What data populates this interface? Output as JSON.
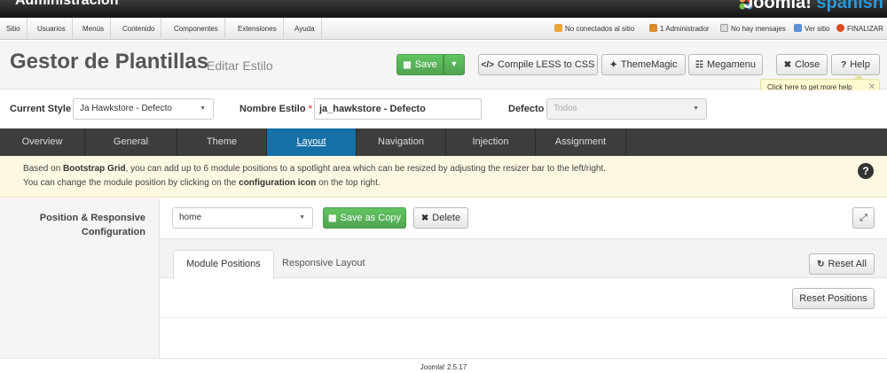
{
  "header": {
    "admin_title": "Administración",
    "logo_text": "Joomla!",
    "logo_suffix": "spanish"
  },
  "menu": {
    "items": [
      "Sitio",
      "Usuarios",
      "Menús",
      "Contenido",
      "Componentes",
      "Extensiones",
      "Ayuda"
    ]
  },
  "status": {
    "not_connected": "No conectados al sitio",
    "admins": "1 Administrador",
    "messages": "No hay mensajes",
    "view_site": "Ver sitio",
    "logout": "FINALIZAR"
  },
  "toolbar": {
    "title": "Gestor de Plantillas",
    "subtitle": "Editar Estilo",
    "save_label": "Save",
    "compile_label": "Compile LESS to CSS",
    "thememagic_label": "ThemeMagic",
    "megamenu_label": "Megamenu",
    "close_label": "Close",
    "help_label": "Help",
    "help_tooltip": "Click here to get more help"
  },
  "style_form": {
    "current_style_label": "Current Style",
    "current_style_value": "Ja Hawkstore - Defecto",
    "style_name_label": "Nombre Estilo",
    "style_name_value": "ja_hawkstore - Defecto",
    "default_label": "Defecto",
    "default_value": "Todos"
  },
  "tabs": [
    "Overview",
    "General",
    "Theme",
    "Layout",
    "Navigation",
    "Injection",
    "Assignment"
  ],
  "active_tab": "Layout",
  "info": {
    "line1_pre": "Based on ",
    "line1_bold": "Bootstrap Grid",
    "line1_post": ", you can add up to 6 module positions to a spotlight area which can be resized by adjusting the resizer bar to the left/right.",
    "line2_pre": "You can change the module position by clicking on the ",
    "line2_bold": "configuration icon",
    "line2_post": " on the top right."
  },
  "config": {
    "label_line1": "Position & Responsive",
    "label_line2": "Configuration",
    "layout_select": "home",
    "save_copy_label": "Save as Copy",
    "delete_label": "Delete",
    "subtabs": [
      "Module Positions",
      "Responsive Layout"
    ],
    "reset_all_label": "Reset All",
    "reset_positions_label": "Reset Positions"
  },
  "footer": {
    "version": "Joomla! 2.5.17"
  },
  "colors": {
    "active_tab": "#1570a6",
    "save_green": "#51a351",
    "info_bg": "#fcf8e1"
  }
}
